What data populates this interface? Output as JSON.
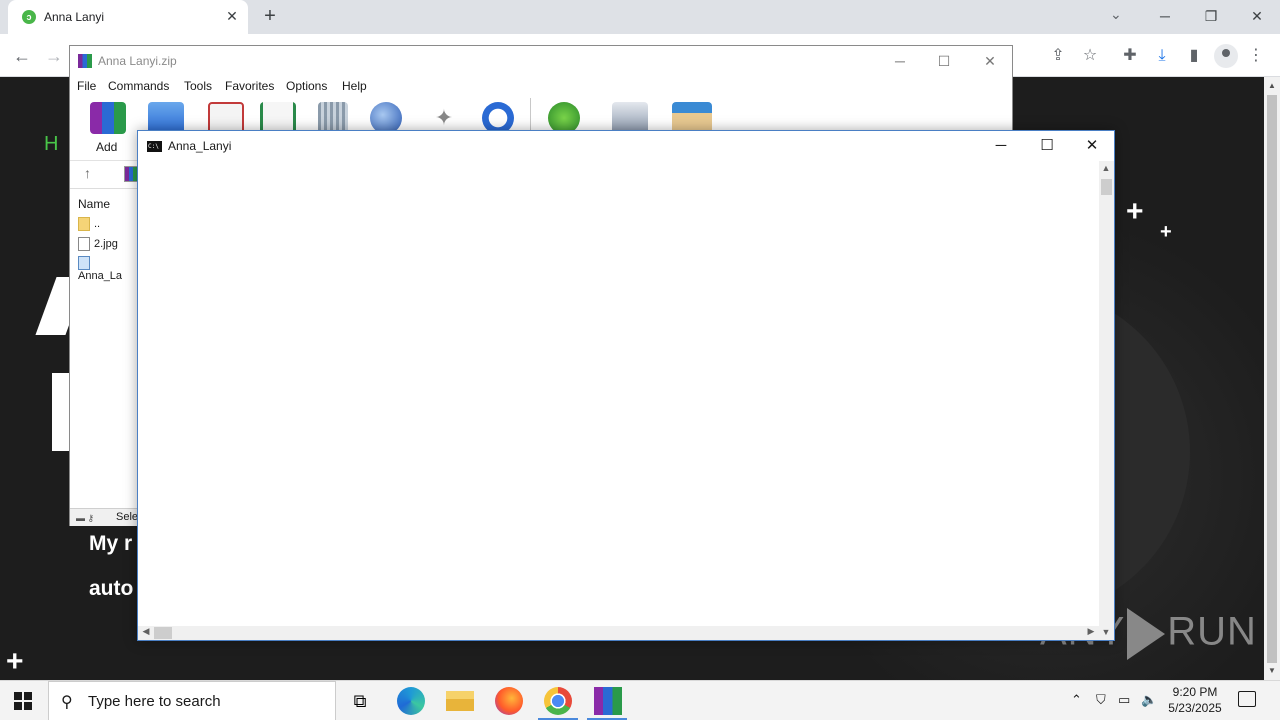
{
  "browser": {
    "tab_title": "Anna Lanyi",
    "tab_close": "✕",
    "new_tab": "+",
    "minimize": "─",
    "restore": "❐",
    "close": "✕"
  },
  "page": {
    "greeting": "H I",
    "line1": "My r",
    "line2": "auto"
  },
  "winrar": {
    "title": "Anna Lanyi.zip",
    "menu": [
      "File",
      "Commands",
      "Tools",
      "Favorites",
      "Options",
      "Help"
    ],
    "add_label": "Add",
    "column_name": "Name",
    "rows": [
      "..",
      "2.jpg",
      "Anna_La"
    ],
    "status_text": "Sele"
  },
  "console": {
    "title": "Anna_Lanyi",
    "minimize": "─",
    "maximize": "☐",
    "close": "✕"
  },
  "taskbar": {
    "search_placeholder": "Type here to search",
    "time": "9:20 PM",
    "date": "5/23/2025"
  },
  "watermark": {
    "left": "ANY",
    "right": "RUN"
  }
}
